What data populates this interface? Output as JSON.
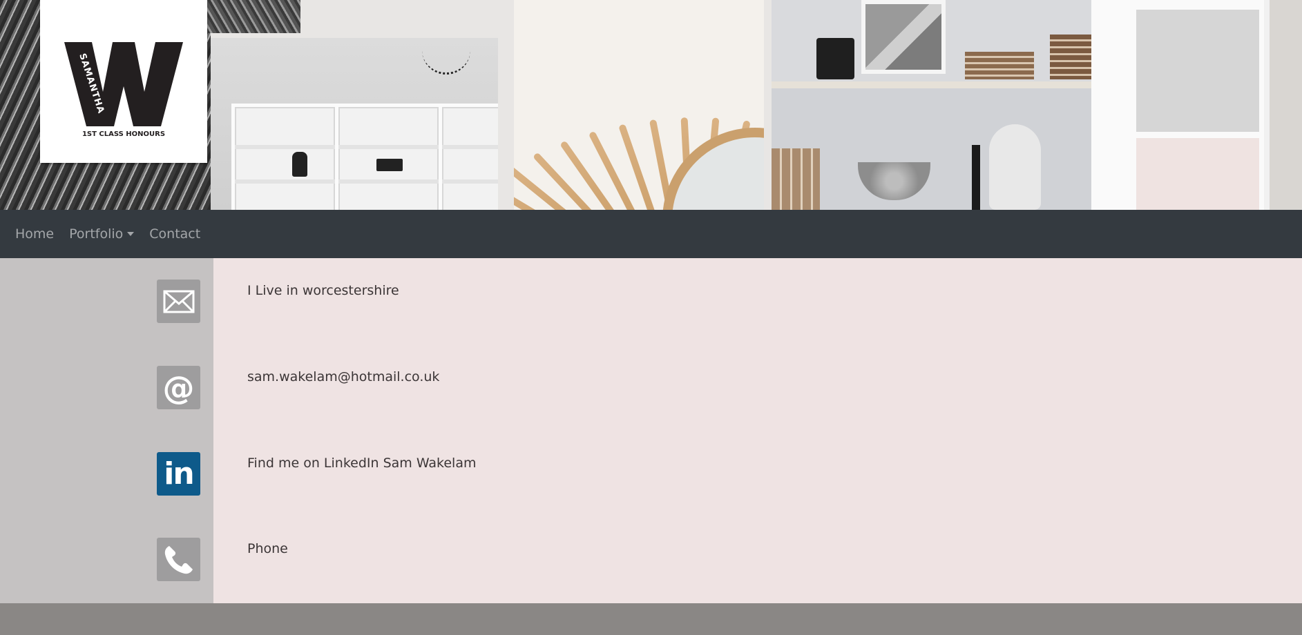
{
  "logo": {
    "letter": "W",
    "name": "SAMANTHA",
    "tagline": "1ST CLASS HONOURS"
  },
  "nav": {
    "items": [
      {
        "label": "Home"
      },
      {
        "label": "Portfolio",
        "has_dropdown": true
      },
      {
        "label": "Contact"
      }
    ]
  },
  "contact": {
    "items": [
      {
        "icon": "envelope-icon",
        "text": "I Live in worcestershire"
      },
      {
        "icon": "at-sign-icon",
        "text": "sam.wakelam@hotmail.co.uk"
      },
      {
        "icon": "linkedin-icon",
        "text": "Find me on LinkedIn Sam Wakelam"
      },
      {
        "icon": "phone-icon",
        "text": "Phone"
      }
    ]
  },
  "colors": {
    "navbar": "#343a40",
    "icon_column": "#c5c2c2",
    "text_column": "#efe3e3",
    "footer": "#8a8785",
    "linkedin_blue": "#0e5a8a",
    "icon_grey": "#9e9d9e"
  }
}
